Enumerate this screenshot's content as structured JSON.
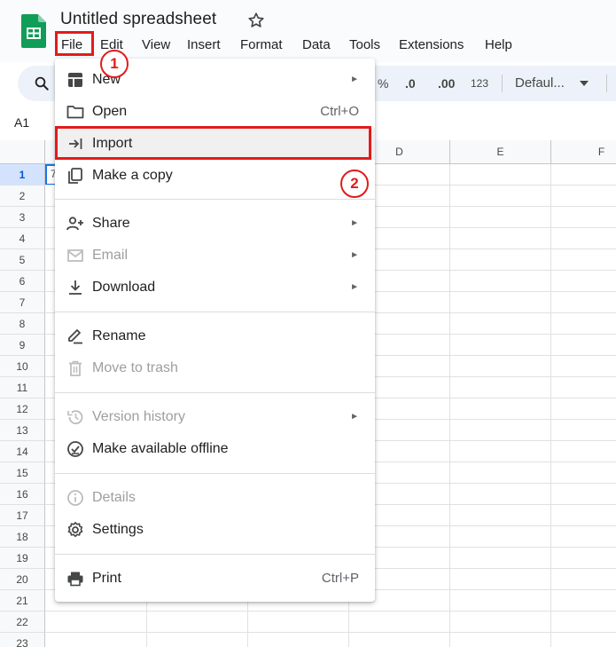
{
  "app": {
    "title": "Untitled spreadsheet",
    "brand_color": "#0f9d58"
  },
  "menubar": [
    "File",
    "Edit",
    "View",
    "Insert",
    "Format",
    "Data",
    "Tools",
    "Extensions",
    "Help"
  ],
  "toolbar": {
    "percent": "%",
    "decrease_decimal": ".0",
    "increase_decimal": ".00",
    "number_format": "123",
    "font": "Defaul..."
  },
  "namebox": "A1",
  "grid": {
    "columns": [
      "D",
      "E",
      "F"
    ],
    "rows": [
      "1",
      "2",
      "3",
      "4",
      "5",
      "6",
      "7",
      "8",
      "9",
      "10",
      "11",
      "12",
      "13",
      "14",
      "15",
      "16",
      "17",
      "18",
      "19",
      "20",
      "21",
      "22",
      "23"
    ],
    "active_row": "1",
    "a1_partial_text": "7"
  },
  "file_menu": {
    "items": [
      {
        "label": "New",
        "icon": "new-sheet-icon",
        "submenu": true,
        "disabled": false
      },
      {
        "label": "Open",
        "icon": "folder-icon",
        "shortcut": "Ctrl+O",
        "disabled": false
      },
      {
        "label": "Import",
        "icon": "import-icon",
        "disabled": false
      },
      {
        "label": "Make a copy",
        "icon": "copy-icon",
        "disabled": false
      },
      {
        "label": "Share",
        "icon": "share-person-icon",
        "submenu": true,
        "disabled": false
      },
      {
        "label": "Email",
        "icon": "email-icon",
        "submenu": true,
        "disabled": true
      },
      {
        "label": "Download",
        "icon": "download-icon",
        "submenu": true,
        "disabled": false
      },
      {
        "label": "Rename",
        "icon": "rename-icon",
        "disabled": false
      },
      {
        "label": "Move to trash",
        "icon": "trash-icon",
        "disabled": true
      },
      {
        "label": "Version history",
        "icon": "history-icon",
        "submenu": true,
        "disabled": true
      },
      {
        "label": "Make available offline",
        "icon": "offline-icon",
        "disabled": false
      },
      {
        "label": "Details",
        "icon": "info-icon",
        "disabled": true
      },
      {
        "label": "Settings",
        "icon": "settings-icon",
        "disabled": false
      },
      {
        "label": "Print",
        "icon": "print-icon",
        "shortcut": "Ctrl+P",
        "disabled": false
      }
    ],
    "submenu_arrow": "►"
  },
  "annotations": {
    "step1": "1",
    "step2": "2",
    "highlight_color": "#e21b1b"
  }
}
